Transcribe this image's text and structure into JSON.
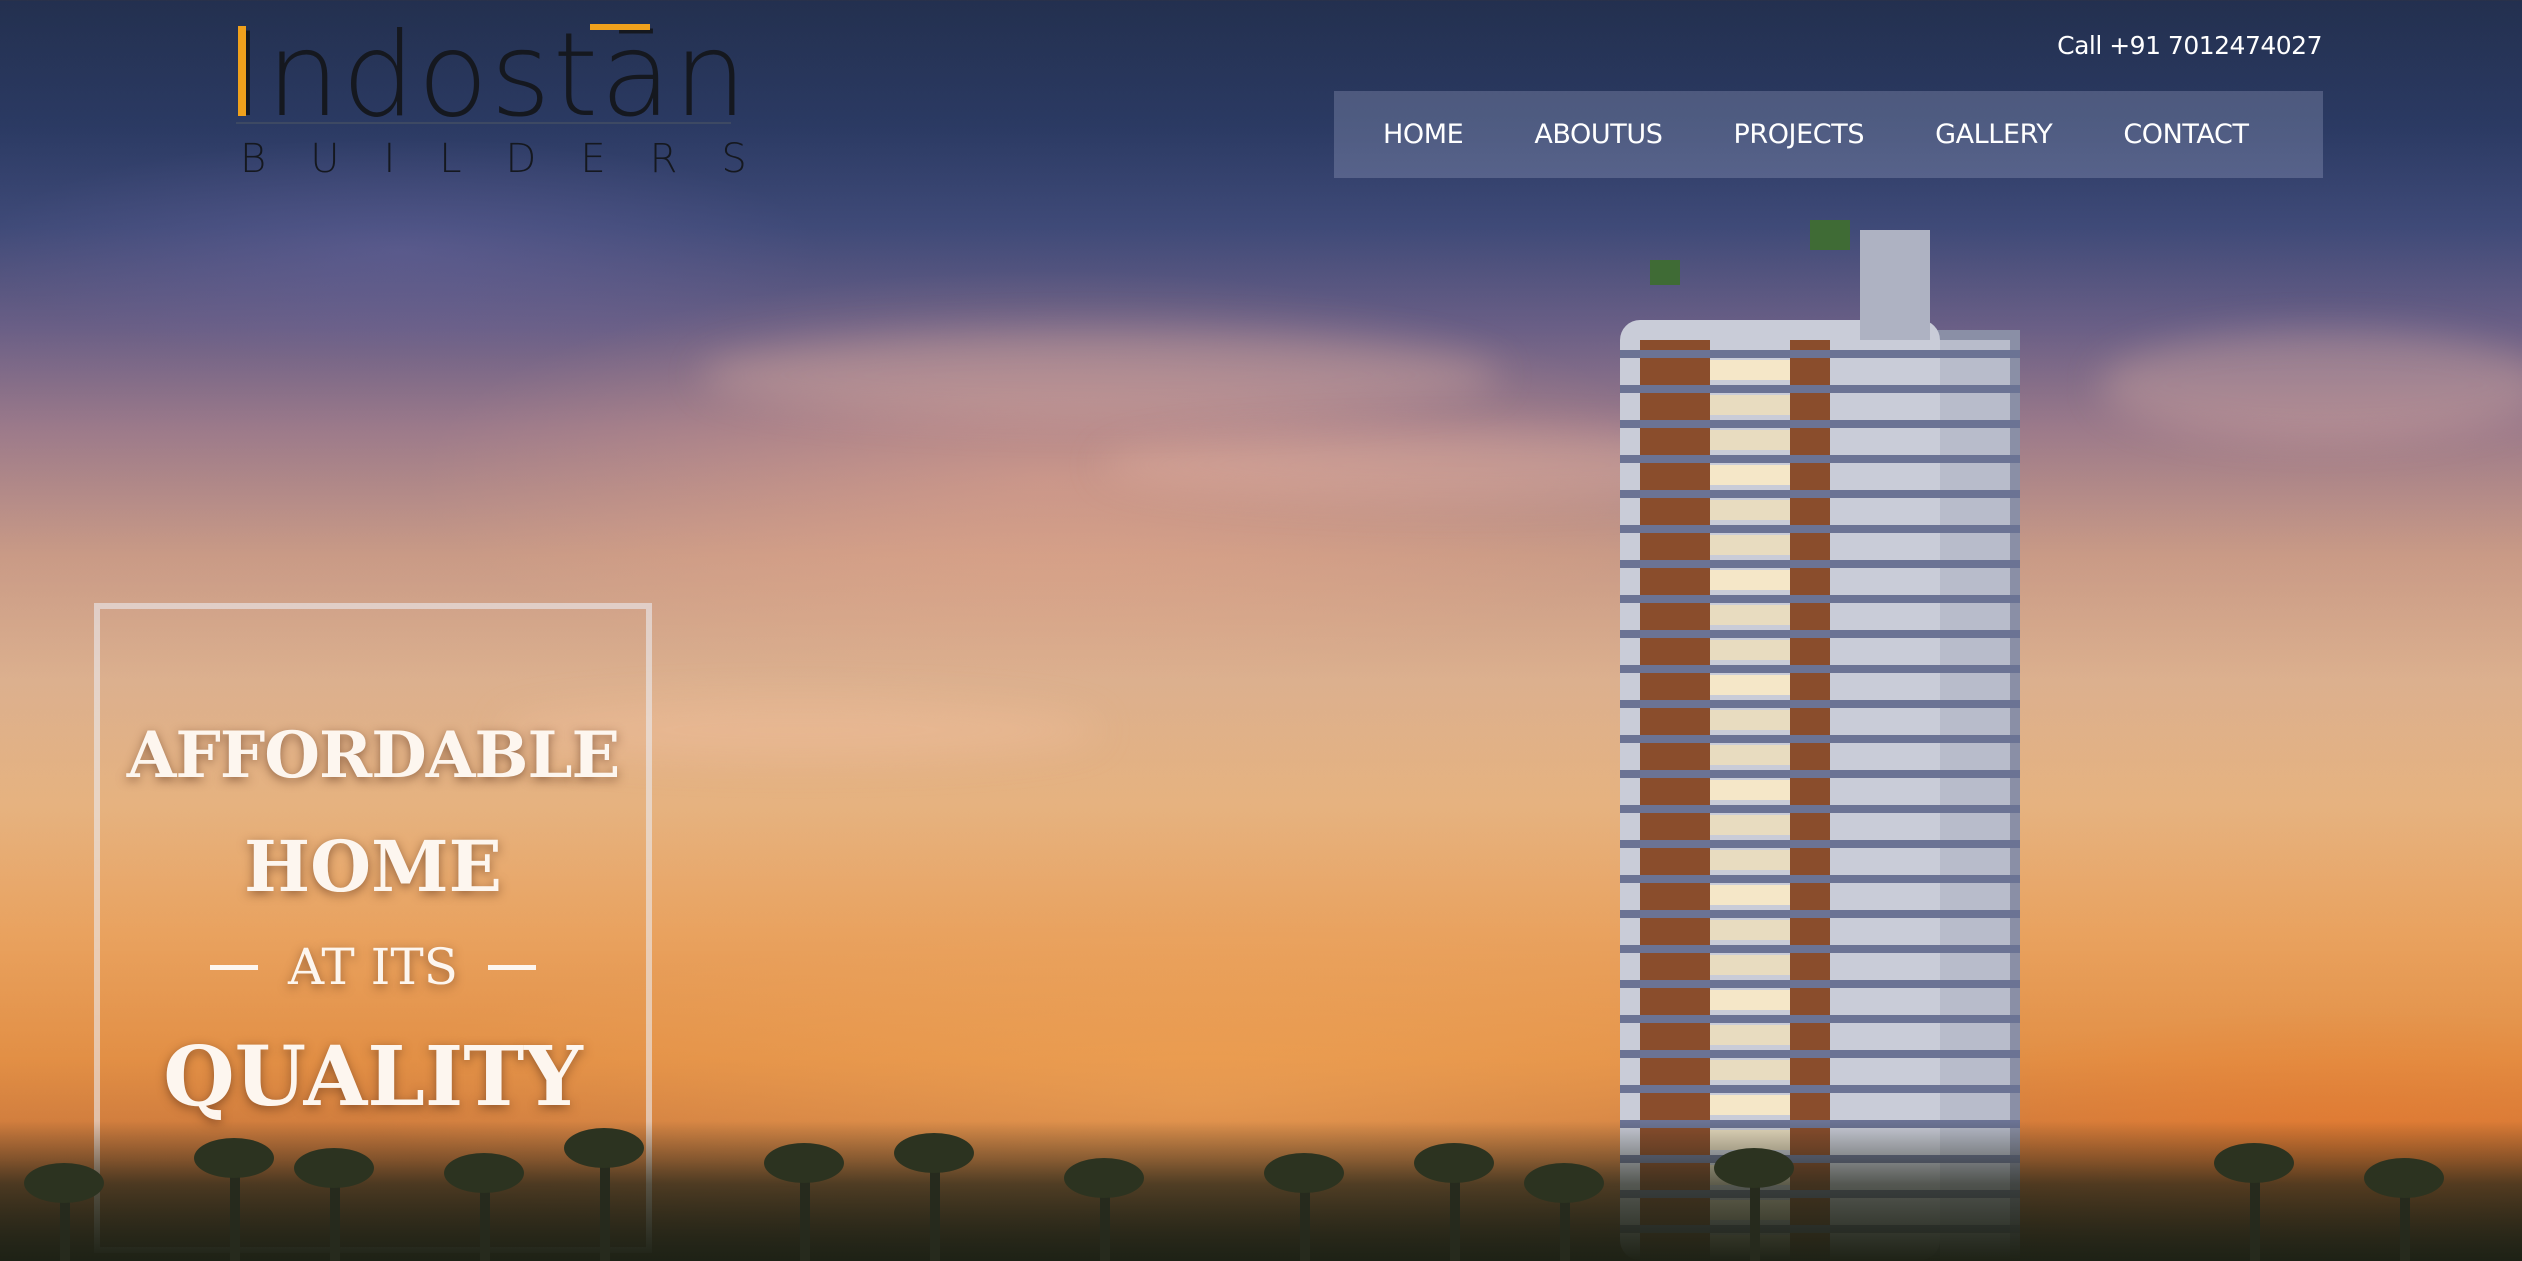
{
  "header": {
    "logo": {
      "word": "Indostān",
      "sub": "BUILDERS"
    },
    "call_text": "Call +91 7012474027",
    "nav": [
      {
        "label": "HOME"
      },
      {
        "label": "ABOUTUS"
      },
      {
        "label": "PROJECTS"
      },
      {
        "label": "GALLERY"
      },
      {
        "label": "CONTACT"
      }
    ]
  },
  "hero": {
    "line1": "AFFORDABLE",
    "line2": "HOME",
    "line3": "AT ITS",
    "line4": "QUALITY"
  },
  "colors": {
    "accent": "#f0a11c",
    "nav_text": "#ffffff",
    "logo_text": "#15181f"
  }
}
